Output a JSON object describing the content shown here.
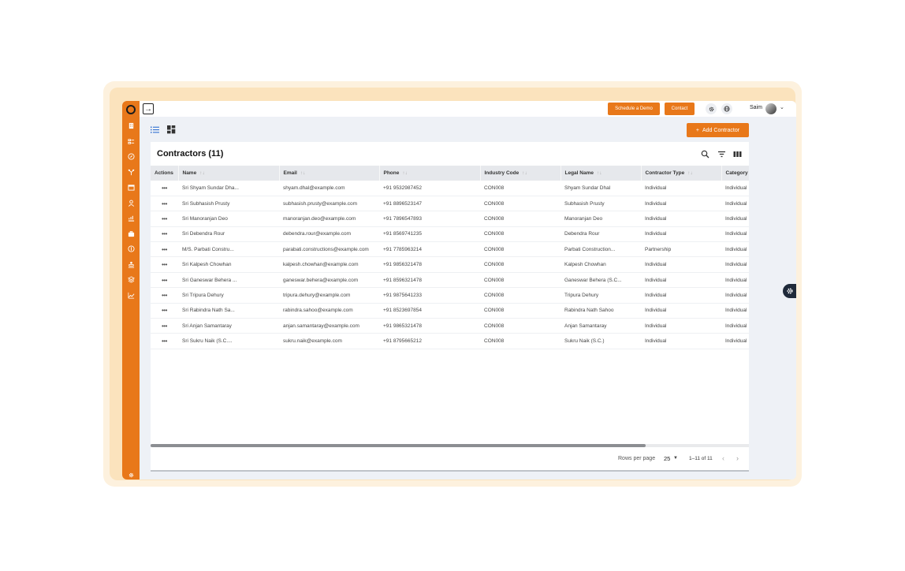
{
  "header": {
    "schedule_demo_label": "Schedule a Demo",
    "contact_label": "Contact",
    "settings_icon": "gear-icon",
    "language_icon": "globe-icon",
    "user_name": "Saim",
    "collapse_icon": "arrow-right-square-icon"
  },
  "sidebar": {
    "icons": [
      "building-icon",
      "list-icon",
      "compass-icon",
      "hierarchy-icon",
      "calendar-icon",
      "user-icon",
      "chart-up-icon",
      "briefcase-icon",
      "coin-icon",
      "person-stand-icon",
      "layers-icon",
      "trend-icon"
    ],
    "bottom_icon": "gear-icon"
  },
  "toolbar": {
    "add_label": "Add Contractor",
    "add_icon": "plus-icon"
  },
  "card": {
    "title": "Contractors (11)"
  },
  "table": {
    "columns": [
      "Actions",
      "Name",
      "Email",
      "Phone",
      "Industry Code",
      "Legal Name",
      "Contractor Type",
      "Category"
    ],
    "rows": [
      {
        "action": "•••",
        "name": "Sri Shyam Sundar Dha...",
        "email": "shyam.dhal@example.com",
        "phone": "+91 9532987452",
        "code": "CON008",
        "legal": "Shyam Sundar Dhal",
        "type": "Individual",
        "category": "Individual"
      },
      {
        "action": "•••",
        "name": "Sri Subhasish Prusty",
        "email": "subhasish.prusty@example.com",
        "phone": "+91 8896523147",
        "code": "CON008",
        "legal": "Subhasish Prusty",
        "type": "Individual",
        "category": "Individual"
      },
      {
        "action": "•••",
        "name": "Sri Manoranjan Deo",
        "email": "manoranjan.deo@example.com",
        "phone": "+91 7896547893",
        "code": "CON008",
        "legal": "Manoranjan Deo",
        "type": "Individual",
        "category": "Individual"
      },
      {
        "action": "•••",
        "name": "Sri Debendra Rour",
        "email": "debendra.rour@example.com",
        "phone": "+91 8569741235",
        "code": "CON008",
        "legal": "Debendra Rour",
        "type": "Individual",
        "category": "Individual"
      },
      {
        "action": "•••",
        "name": "M/S. Parbati Constru...",
        "email": "parabati.constructions@example.com",
        "phone": "+91 7785963214",
        "code": "CON008",
        "legal": "Parbati Construction...",
        "type": "Partnership",
        "category": "Individual"
      },
      {
        "action": "•••",
        "name": "Sri Kalpesh Chowhan",
        "email": "kalpesh.chowhan@example.com",
        "phone": "+91 9856321478",
        "code": "CON008",
        "legal": "Kalpesh Chowhan",
        "type": "Individual",
        "category": "Individual"
      },
      {
        "action": "•••",
        "name": "Sri Ganeswar Behera ...",
        "email": "ganeswar.behera@example.com",
        "phone": "+91 8596321478",
        "code": "CON008",
        "legal": "Ganeswar Behera (S.C...",
        "type": "Individual",
        "category": "Individual"
      },
      {
        "action": "•••",
        "name": "Sri Tripura Dehury",
        "email": "tripura.dehury@example.com",
        "phone": "+91 9875641233",
        "code": "CON008",
        "legal": "Tripura Dehury",
        "type": "Individual",
        "category": "Individual"
      },
      {
        "action": "•••",
        "name": "Sri Rabindra Nath Sa...",
        "email": "rabindra.sahoo@example.com",
        "phone": "+91 8523697854",
        "code": "CON008",
        "legal": "Rabindra Nath Sahoo",
        "type": "Individual",
        "category": "Individual"
      },
      {
        "action": "•••",
        "name": "Sri Anjan Samantaray",
        "email": "anjan.samantaray@example.com",
        "phone": "+91 9865321478",
        "code": "CON008",
        "legal": "Anjan Samantaray",
        "type": "Individual",
        "category": "Individual"
      },
      {
        "action": "•••",
        "name": "Sri Sukru Naik (S.C....",
        "email": "sukru.naik@example.com",
        "phone": "+91 8795665212",
        "code": "CON008",
        "legal": "Sukru Naik (S.C.)",
        "type": "Individual",
        "category": "Individual"
      }
    ]
  },
  "pagination": {
    "rows_per_page_label": "Rows per page",
    "rows_per_page_value": "25",
    "range_text": "1–11 of 11",
    "prev_icon": "chevron-left-icon",
    "next_icon": "chevron-right-icon"
  },
  "colors": {
    "accent": "#e8781a",
    "header_row": "#e6e8ec",
    "app_bg": "#eef1f6"
  }
}
